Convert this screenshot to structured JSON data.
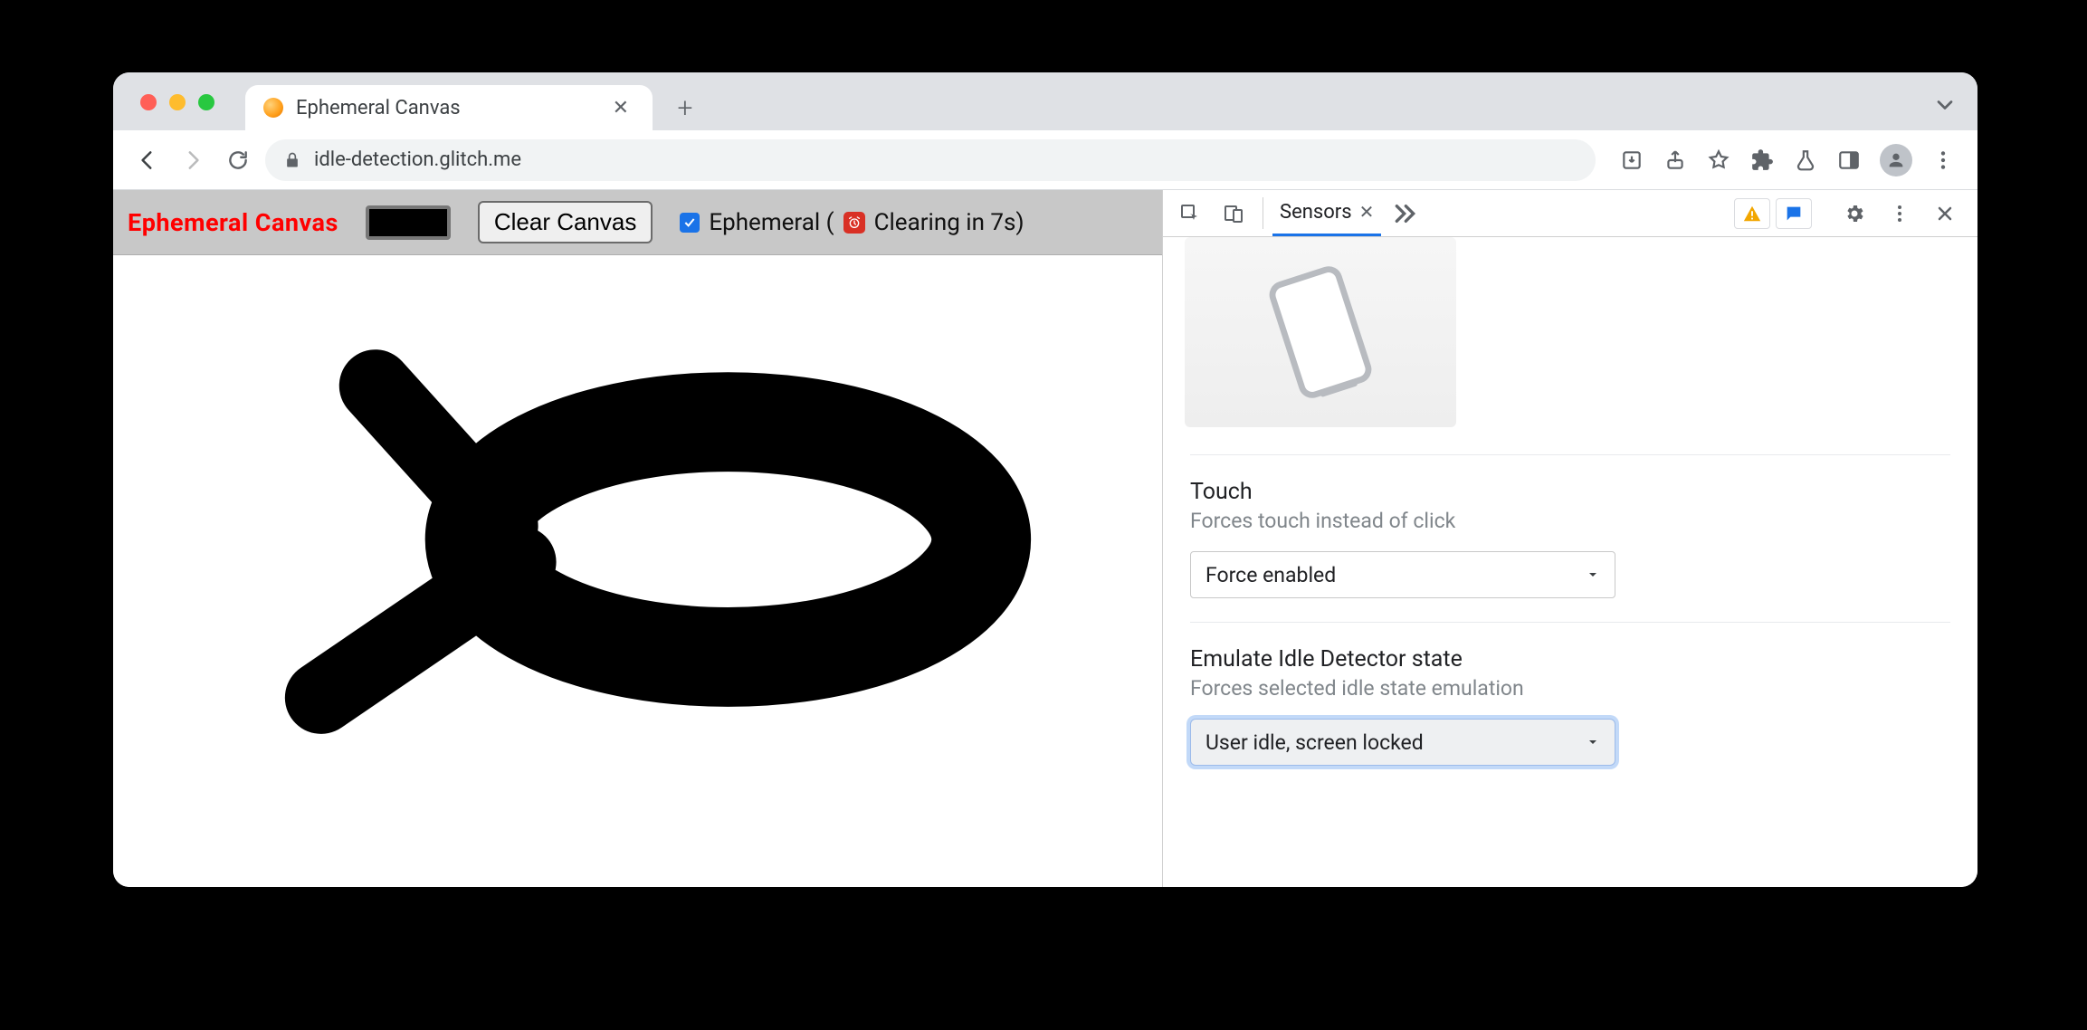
{
  "browser": {
    "tab_title": "Ephemeral Canvas",
    "url": "idle-detection.glitch.me"
  },
  "page": {
    "title": "Ephemeral Canvas",
    "clear_button": "Clear Canvas",
    "ephemeral_label_prefix": "Ephemeral (",
    "clearing_text": " Clearing in 7s)",
    "stroke_color": "#000000"
  },
  "devtools": {
    "active_tab": "Sensors",
    "touch": {
      "title": "Touch",
      "subtitle": "Forces touch instead of click",
      "value": "Force enabled"
    },
    "idle": {
      "title": "Emulate Idle Detector state",
      "subtitle": "Forces selected idle state emulation",
      "value": "User idle, screen locked"
    }
  }
}
